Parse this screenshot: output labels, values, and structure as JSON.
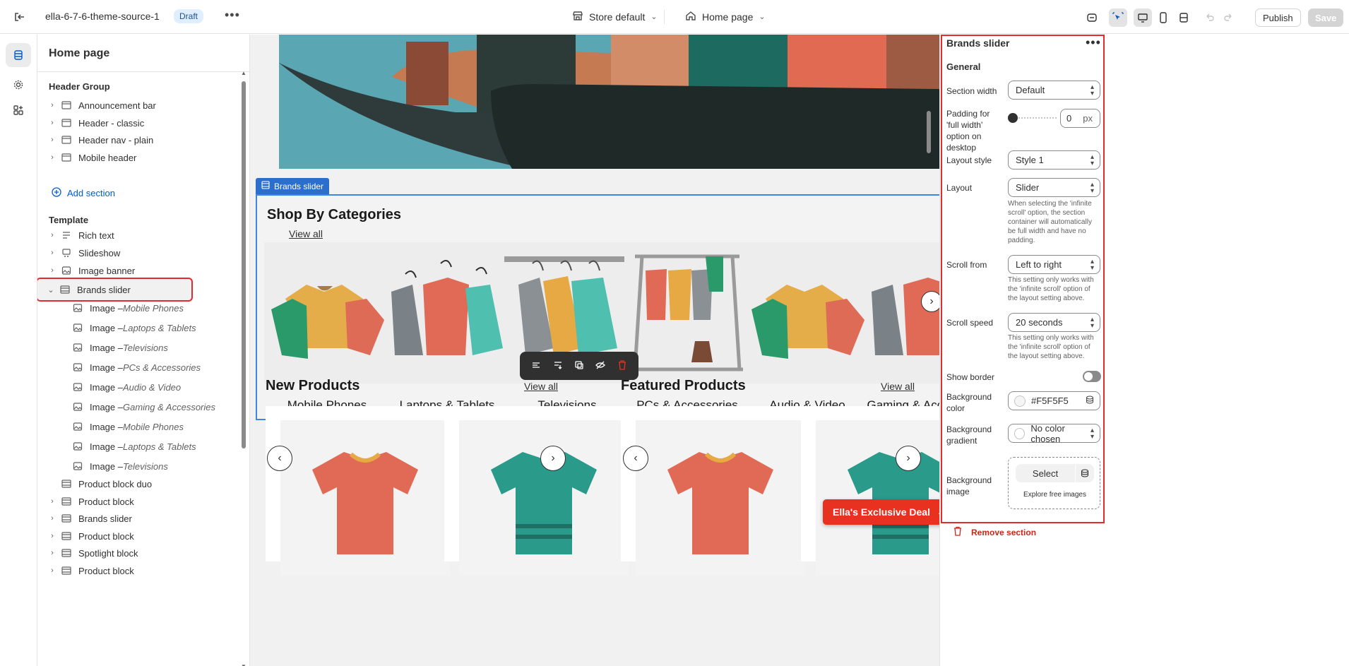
{
  "topbar": {
    "theme_name": "ella-6-7-6-theme-source-1",
    "status_badge": "Draft",
    "store_selector": "Store default",
    "page_selector": "Home page",
    "publish_label": "Publish",
    "save_label": "Save"
  },
  "sidebar": {
    "title": "Home page",
    "header_group_label": "Header Group",
    "header_items": [
      {
        "label": "Announcement bar"
      },
      {
        "label": "Header - classic"
      },
      {
        "label": "Header nav - plain"
      },
      {
        "label": "Mobile header"
      }
    ],
    "add_section_label": "Add section",
    "template_label": "Template",
    "template_items": [
      {
        "label": "Rich text"
      },
      {
        "label": "Slideshow"
      },
      {
        "label": "Image banner"
      },
      {
        "label": "Brands slider"
      }
    ],
    "brand_blocks": [
      {
        "prefix": "Image – ",
        "name": "Mobile Phones"
      },
      {
        "prefix": "Image – ",
        "name": "Laptops & Tablets"
      },
      {
        "prefix": "Image – ",
        "name": "Televisions"
      },
      {
        "prefix": "Image – ",
        "name": "PCs & Accessories"
      },
      {
        "prefix": "Image – ",
        "name": "Audio & Video"
      },
      {
        "prefix": "Image – ",
        "name": "Gaming & Accessories"
      },
      {
        "prefix": "Image – ",
        "name": "Mobile Phones"
      },
      {
        "prefix": "Image – ",
        "name": "Laptops & Tablets"
      },
      {
        "prefix": "Image – ",
        "name": "Televisions"
      }
    ],
    "after_items": [
      {
        "label": "Product block duo"
      },
      {
        "label": "Product block"
      },
      {
        "label": "Brands slider"
      },
      {
        "label": "Product block"
      },
      {
        "label": "Spotlight block"
      },
      {
        "label": "Product block"
      }
    ]
  },
  "canvas": {
    "section_tag": "Brands slider",
    "categories_title": "Shop By Categories",
    "categories_view_all": "View all",
    "categories": [
      {
        "label": "Mobile Phones"
      },
      {
        "label": "Laptops & Tablets"
      },
      {
        "label": "Televisions"
      },
      {
        "label": "PCs & Accessories"
      },
      {
        "label": "Audio & Video"
      },
      {
        "label": "Gaming & Accessories"
      }
    ],
    "new_products_title": "New Products",
    "new_products_view_all": "View all",
    "featured_products_title": "Featured Products",
    "featured_products_view_all": "View all",
    "promo_label": "Ella's Exclusive Deal"
  },
  "inspector": {
    "title": "Brands slider",
    "general_label": "General",
    "section_width_label": "Section width",
    "section_width_value": "Default",
    "padding_label": "Padding for 'full width' option on desktop",
    "padding_value": "0",
    "padding_unit": "px",
    "layout_style_label": "Layout style",
    "layout_style_value": "Style 1",
    "layout_label": "Layout",
    "layout_value": "Slider",
    "layout_help": "When selecting the 'infinite scroll' option, the section container will automatically be full width and have no padding.",
    "scroll_from_label": "Scroll from",
    "scroll_from_value": "Left to right",
    "scroll_from_help": "This setting only works with the 'infinite scroll' option of the layout setting above.",
    "scroll_speed_label": "Scroll speed",
    "scroll_speed_value": "20 seconds",
    "scroll_speed_help": "This setting only works with the 'infinite scroll' option of the layout setting above.",
    "show_border_label": "Show border",
    "show_border_on": false,
    "bg_color_label": "Background color",
    "bg_color_value": "#F5F5F5",
    "bg_gradient_label": "Background gradient",
    "bg_gradient_value": "No color chosen",
    "bg_image_label": "Background image",
    "select_label": "Select",
    "explore_label": "Explore free images",
    "remove_label": "Remove section"
  },
  "colors": {
    "highlight_red": "#e22b2b",
    "section_blue": "#3d85e8",
    "link_blue": "#005bd3",
    "promo_red": "#e8321f"
  }
}
